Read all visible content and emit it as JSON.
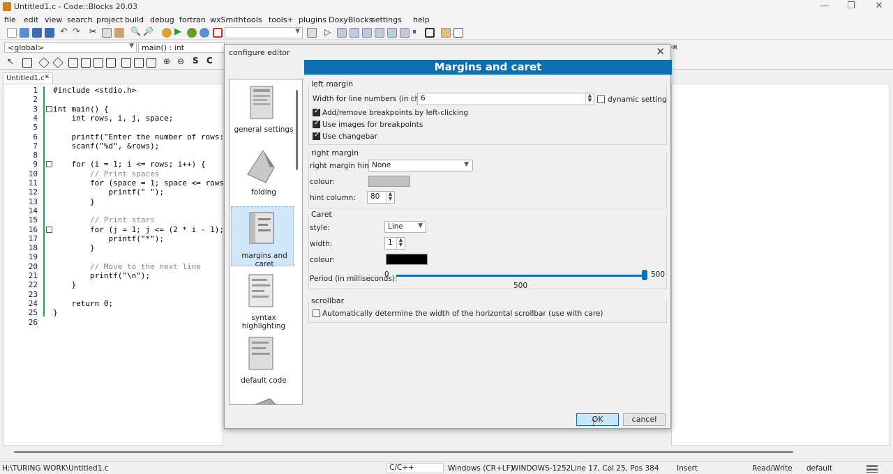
{
  "window": {
    "title": "Untitled1.c - Code::Blocks 20.03",
    "min_icon": "minimize-icon",
    "max_icon": "maximize-icon",
    "close_icon": "close-icon"
  },
  "menu": [
    "file",
    "edit",
    "view",
    "search",
    "project",
    "build",
    "debug",
    "fortran",
    "wxSmith",
    "tools",
    "tools+",
    "plugins",
    "DoxyBlocks",
    "settings",
    "help"
  ],
  "toolbar": {
    "scope_value": "<global>",
    "function_value": "main() : int",
    "jump_icon": "jump-arrow-icon"
  },
  "editor": {
    "tab_label": "Untitled1.c",
    "line_numbers": [
      "1",
      "2",
      "3",
      "4",
      "5",
      "6",
      "7",
      "8",
      "9",
      "10",
      "11",
      "12",
      "13",
      "14",
      "15",
      "16",
      "17",
      "18",
      "19",
      "20",
      "21",
      "22",
      "23",
      "24",
      "25",
      "26"
    ],
    "lines": [
      "#include <stdio.h>",
      "",
      "int main() {",
      "    int rows, i, j, space;",
      "",
      "    printf(\"Enter the number of rows:",
      "    scanf(\"%d\", &rows);",
      "",
      "    for (i = 1; i <= rows; i++) {",
      "        // Print spaces",
      "        for (space = 1; space <= rows",
      "            printf(\" \");",
      "        }",
      "",
      "        // Print stars",
      "        for (j = 1; j <= (2 * i - 1);",
      "            printf(\"*\");",
      "        }",
      "",
      "        // Move to the next line",
      "        printf(\"\\n\");",
      "    }",
      "",
      "    return 0;",
      "}",
      ""
    ]
  },
  "dialog": {
    "title": "configure editor",
    "page_header": "Margins and caret",
    "categories": [
      "general settings",
      "folding",
      "margins and caret",
      "syntax highlighting",
      "default code"
    ],
    "left_margin": {
      "group": "left margin",
      "width_label": "Width for line numbers (in chars):",
      "width_value": "6",
      "dynamic_label": "dynamic setting",
      "breakpoints_label": "Add/remove breakpoints by left-clicking",
      "images_label": "Use images for breakpoints",
      "changebar_label": "Use changebar"
    },
    "right_margin": {
      "group": "right margin",
      "hint_label": "right margin hint:",
      "hint_value": "None",
      "colour_label": "colour:",
      "colour": "#c0c0c0",
      "hint_col_label": "hint column:",
      "hint_col_value": "80"
    },
    "caret": {
      "group": "Caret",
      "style_label": "style:",
      "style_value": "Line",
      "width_label": "width:",
      "width_value": "1",
      "colour_label": "colour:",
      "colour": "#000000",
      "period_label": "Period (in milliseconds):",
      "period_min": "0",
      "period_max": "500",
      "period_value": "500",
      "period_fraction": 1.0
    },
    "scrollbar": {
      "group": "scrollbar",
      "auto_label": "Automatically determine the width of the horizontal scrollbar (use with care)"
    },
    "ok_label": "OK",
    "cancel_label": "cancel"
  },
  "status": {
    "path": "H:\\TURING WORK\\Untitled1.c",
    "language": "C/C++",
    "eol": "Windows (CR+LF)",
    "encoding": "WINDOWS-1252",
    "position": "Line 17, Col 25, Pos 384",
    "mode": "Insert",
    "access": "Read/Write",
    "profile": "default"
  },
  "accent": "#0b6fb3"
}
